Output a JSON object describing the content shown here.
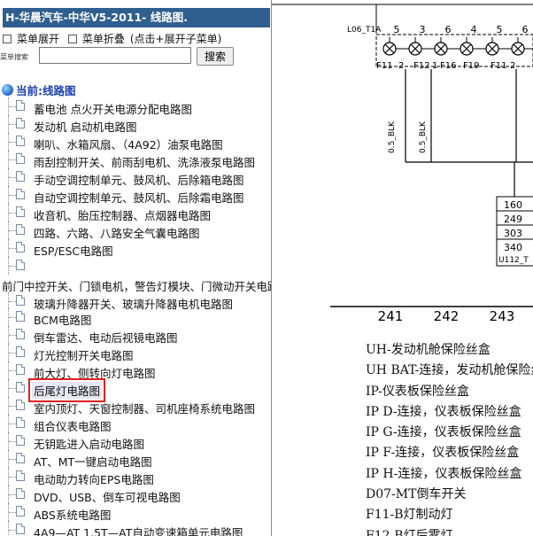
{
  "title": "H-华晨汽车-中华V5-2011- 线路图.",
  "controls": {
    "expand": "菜单展开",
    "collapse": "菜单折叠",
    "hint": "(点击+展开子菜单)"
  },
  "search": {
    "label": "菜单搜索",
    "value": "",
    "button": "搜索"
  },
  "tree": {
    "root": "当前:线路图",
    "items": [
      "蓄电池 点火开关电源分配电路图",
      "发动机 启动机电路图",
      "喇叭、水箱风扇、（4A92）油泵电路图",
      "雨刮控制开关、前雨刮电机、洗涤液泵电路图",
      "手动空调控制单元、鼓风机、后除箱电路图",
      "自动空调控制单元、鼓风机、后除霜电路图",
      "收音机、胎压控制器、点烟器电路图",
      "四路、六路、八路安全气囊电路图",
      "ESP/ESC电路图",
      "",
      "前门中控开关、门锁电机，警告灯模块、门微动开关电路图",
      "玻璃升降器开关、玻璃升降器电机电路图",
      "BCM电路图",
      "倒车雷达、电动后视镜电路图",
      "灯光控制开关电路图",
      "前大灯、侧转向灯电路图",
      "后尾灯电路图",
      "室内顶灯、天窗控制器、司机座椅系统电路图",
      "组合仪表电路图",
      "无钥匙进入启动电路图",
      "AT、MT一键启动电路图",
      "电动助力转向EPS电路图",
      "DVD、USB、倒车可视电路图",
      "ABS系统电路图",
      "4A9—AT 1.5T—AT自动变速箱单元电路图"
    ],
    "selected_index": 16
  },
  "diagram": {
    "fuse_label": "L06_T1A",
    "top_numbers": [
      "5",
      "3",
      "6",
      "4",
      "5",
      "6"
    ],
    "fuse_names": [
      "F11",
      "2",
      "F12",
      "1",
      "F16",
      "F19",
      "F11",
      "2"
    ],
    "wire_labels": [
      "0.5_BLK",
      "0.5_BLK"
    ],
    "connector_pins": [
      "160",
      "249",
      "303",
      "340"
    ],
    "connector_name": "U112_T",
    "bottom_numbers": [
      "241",
      "242",
      "243"
    ],
    "captions": [
      "UH-发动机舱保险丝盒",
      "UH BAT-连接，发动机舱保险丝盒",
      "IP-仪表板保险丝盒",
      "IP D-连接，仪表板保险丝盒",
      "IP G-连接，仪表板保险丝盒",
      "IP F-连接，仪表板保险丝盒",
      "IP H-连接，仪表板保险丝盒",
      "D07-MT倒车开关",
      "F11-B灯制动灯",
      "F12-B灯后雾灯"
    ]
  }
}
